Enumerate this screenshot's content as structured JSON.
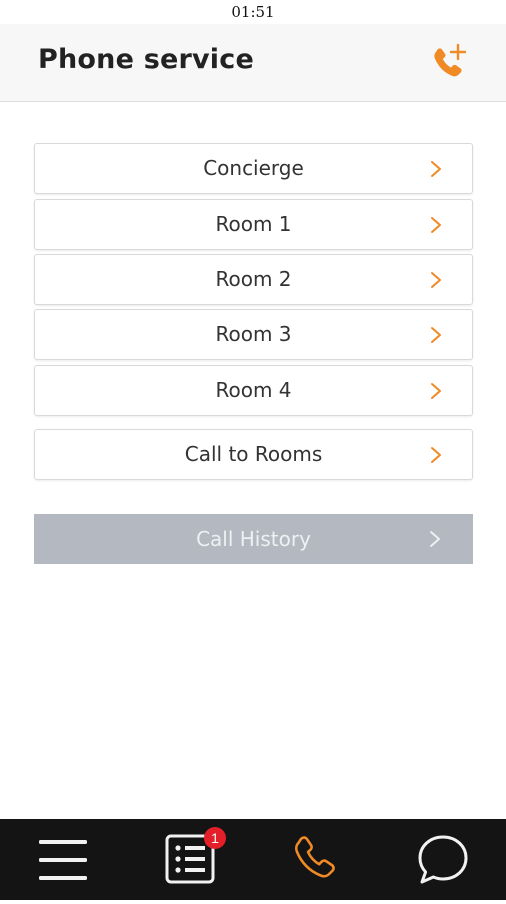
{
  "status_bar": {
    "time": "01:51"
  },
  "header": {
    "title": "Phone service",
    "add_call_icon": "phone-plus-icon"
  },
  "colors": {
    "accent": "#f08a24",
    "header_bg": "#f7f7f7",
    "history_bg": "#b3b8c1",
    "nav_bg": "#141414",
    "badge_bg": "#e3202a"
  },
  "call_list": {
    "items": [
      {
        "label": "Concierge"
      },
      {
        "label": "Room 1"
      },
      {
        "label": "Room 2"
      },
      {
        "label": "Room 3"
      },
      {
        "label": "Room 4"
      },
      {
        "label": "Call to Rooms"
      }
    ]
  },
  "call_history": {
    "label": "Call History"
  },
  "bottom_nav": {
    "items": [
      {
        "icon": "hamburger-menu-icon"
      },
      {
        "icon": "list-icon",
        "badge": "1"
      },
      {
        "icon": "phone-icon",
        "active": true
      },
      {
        "icon": "chat-bubble-icon"
      }
    ]
  }
}
